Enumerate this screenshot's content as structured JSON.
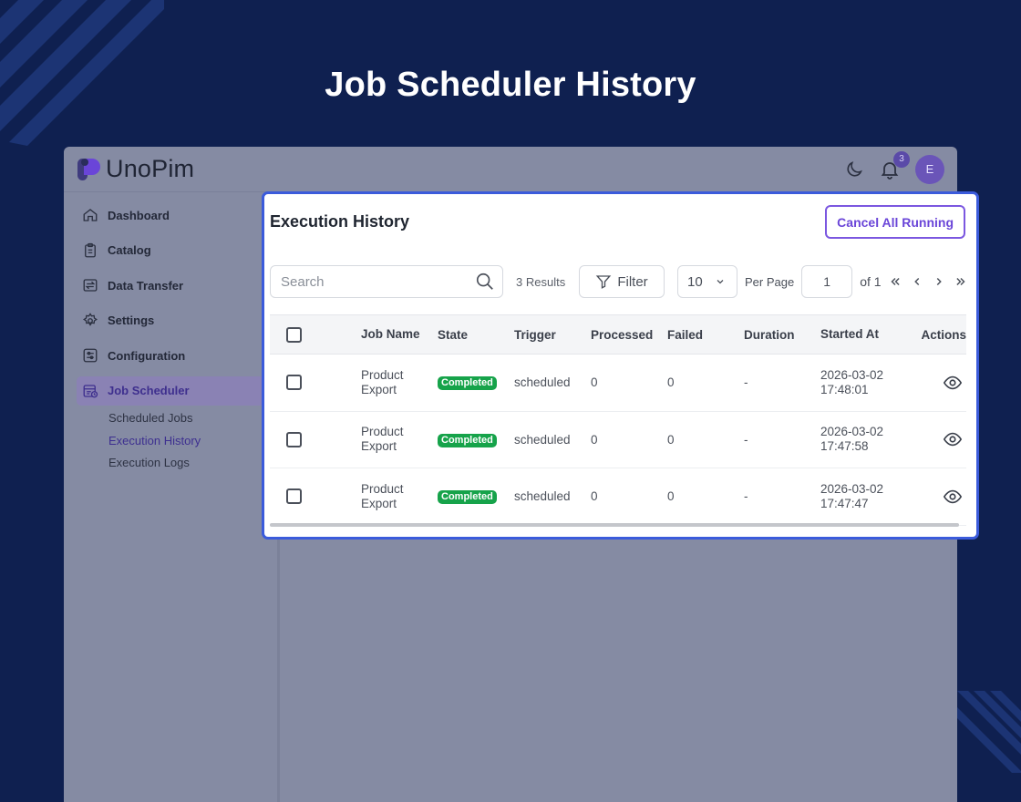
{
  "page": {
    "heading": "Job Scheduler History"
  },
  "app": {
    "logo_text": "UnoPim",
    "notification_count": "3",
    "avatar_initial": "E",
    "accent_color": "#6a45d8"
  },
  "sidebar": {
    "items": [
      {
        "label": "Dashboard",
        "icon": "home-icon"
      },
      {
        "label": "Catalog",
        "icon": "clipboard-icon"
      },
      {
        "label": "Data Transfer",
        "icon": "transfer-icon"
      },
      {
        "label": "Settings",
        "icon": "gear-icon"
      },
      {
        "label": "Configuration",
        "icon": "sliders-icon"
      },
      {
        "label": "Job Scheduler",
        "icon": "scheduler-icon",
        "active": true
      }
    ],
    "subitems": [
      {
        "label": "Scheduled Jobs"
      },
      {
        "label": "Execution History",
        "active": true
      },
      {
        "label": "Execution Logs"
      }
    ]
  },
  "panel": {
    "title": "Execution History",
    "cancel_label": "Cancel All Running",
    "search_placeholder": "Search",
    "results_label": "3 Results",
    "filter_label": "Filter",
    "per_page_value": "10",
    "per_page_label": "Per Page",
    "page_value": "1",
    "page_of": "of 1"
  },
  "table": {
    "columns": [
      "Job Name",
      "State",
      "Trigger",
      "Processed",
      "Failed",
      "Duration",
      "Started At",
      "Actions"
    ],
    "rows": [
      {
        "job_name": "Product Export",
        "state": "Completed",
        "trigger": "scheduled",
        "processed": "0",
        "failed": "0",
        "duration": "-",
        "started_at": "2026-03-02 17:48:01"
      },
      {
        "job_name": "Product Export",
        "state": "Completed",
        "trigger": "scheduled",
        "processed": "0",
        "failed": "0",
        "duration": "-",
        "started_at": "2026-03-02 17:47:58"
      },
      {
        "job_name": "Product Export",
        "state": "Completed",
        "trigger": "scheduled",
        "processed": "0",
        "failed": "0",
        "duration": "-",
        "started_at": "2026-03-02 17:47:47"
      }
    ]
  }
}
